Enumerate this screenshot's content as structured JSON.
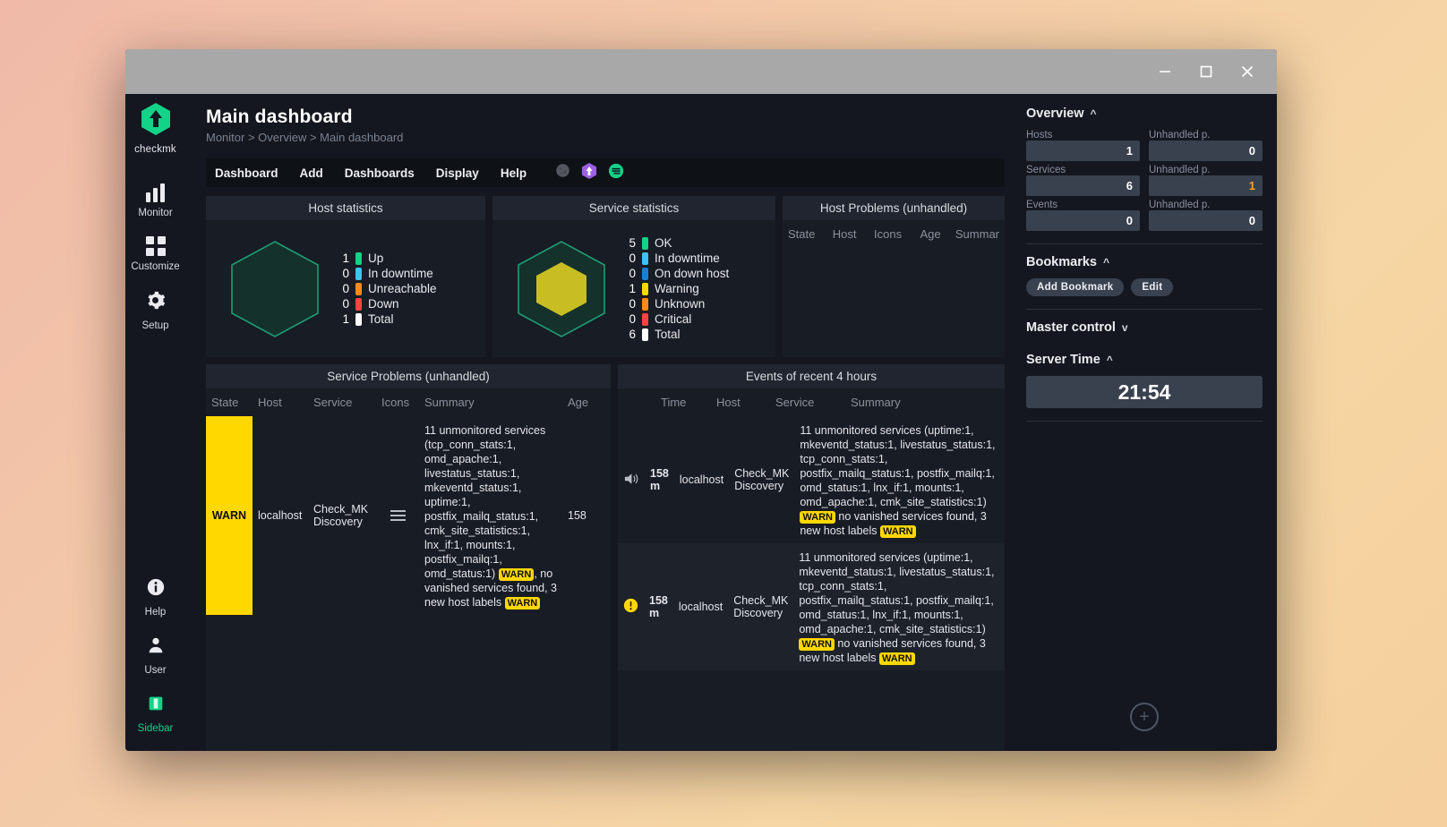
{
  "window": {
    "minimize_label": "minimize",
    "maximize_label": "maximize",
    "close_label": "close"
  },
  "leftnav": {
    "logo_text": "checkmk",
    "items": [
      {
        "label": "Monitor",
        "icon": "bar-chart-icon"
      },
      {
        "label": "Customize",
        "icon": "grid-icon"
      },
      {
        "label": "Setup",
        "icon": "gear-icon"
      }
    ],
    "bottom_items": [
      {
        "label": "Help",
        "icon": "info-icon"
      },
      {
        "label": "User",
        "icon": "person-icon"
      },
      {
        "label": "Sidebar",
        "icon": "sidebar-toggle-icon"
      }
    ]
  },
  "header": {
    "title": "Main dashboard",
    "breadcrumb": "Monitor > Overview > Main dashboard"
  },
  "menubar": {
    "items": [
      "Dashboard",
      "Add",
      "Dashboards",
      "Display",
      "Help"
    ],
    "icons": [
      "moon-icon",
      "checkmk-hexagon-icon",
      "burger-circle-icon"
    ]
  },
  "host_statistics": {
    "title": "Host statistics",
    "rows": [
      {
        "count": "1",
        "label": "Up",
        "color": "#13d388"
      },
      {
        "count": "0",
        "label": "In downtime",
        "color": "#3fc3f0"
      },
      {
        "count": "0",
        "label": "Unreachable",
        "color": "#ff8c1a"
      },
      {
        "count": "0",
        "label": "Down",
        "color": "#f9453f"
      },
      {
        "count": "1",
        "label": "Total",
        "color": "#ffffff"
      }
    ]
  },
  "service_statistics": {
    "title": "Service statistics",
    "rows": [
      {
        "count": "5",
        "label": "OK",
        "color": "#13d388"
      },
      {
        "count": "0",
        "label": "In downtime",
        "color": "#3fc3f0"
      },
      {
        "count": "0",
        "label": "On down host",
        "color": "#1c7fd1"
      },
      {
        "count": "1",
        "label": "Warning",
        "color": "#ffd800"
      },
      {
        "count": "0",
        "label": "Unknown",
        "color": "#ff8c1a"
      },
      {
        "count": "0",
        "label": "Critical",
        "color": "#f9453f"
      },
      {
        "count": "6",
        "label": "Total",
        "color": "#ffffff"
      }
    ]
  },
  "host_problems": {
    "title": "Host Problems (unhandled)",
    "columns": [
      "State",
      "Host",
      "Icons",
      "Age",
      "Summar"
    ],
    "rows": []
  },
  "service_problems": {
    "title": "Service Problems (unhandled)",
    "columns": [
      "State",
      "Host",
      "Service",
      "Icons",
      "Summary",
      "Age"
    ],
    "rows": [
      {
        "state": "WARN",
        "host": "localhost",
        "service": "Check_MK Discovery",
        "icons": "hamburger-icon",
        "summary_pre": "11 unmonitored services (tcp_conn_stats:1, omd_apache:1, livestatus_status:1, mkeventd_status:1, uptime:1, postfix_mailq_status:1, cmk_site_statistics:1, lnx_if:1, mounts:1, postfix_mailq:1, omd_status:1)",
        "badge1": "WARN",
        "summary_mid": ", no vanished services found, 3 new host labels ",
        "badge2": "WARN",
        "age": "158"
      }
    ]
  },
  "events": {
    "title": "Events of recent 4 hours",
    "columns": [
      "Time",
      "Host",
      "Service",
      "Summary"
    ],
    "rows": [
      {
        "icon": "speaker-icon",
        "time": "158 m",
        "host": "localhost",
        "service": "Check_MK Discovery",
        "summary_pre": "11 unmonitored services (uptime:1, mkeventd_status:1, livestatus_status:1, tcp_conn_stats:1, postfix_mailq_status:1, postfix_mailq:1, omd_status:1, lnx_if:1, mounts:1, omd_apache:1, cmk_site_statistics:1)",
        "badge1": "WARN",
        "summary_mid": " no vanished services found, 3 new host labels ",
        "badge2": "WARN"
      },
      {
        "icon": "warning-circle-icon",
        "time": "158 m",
        "host": "localhost",
        "service": "Check_MK Discovery",
        "summary_pre": "11 unmonitored services (uptime:1, mkeventd_status:1, livestatus_status:1, tcp_conn_stats:1, postfix_mailq_status:1, postfix_mailq:1, omd_status:1, lnx_if:1, mounts:1, omd_apache:1, cmk_site_statistics:1)",
        "badge1": "WARN",
        "summary_mid": " no vanished services found, 3 new host labels ",
        "badge2": "WARN"
      }
    ]
  },
  "sidebar": {
    "overview": {
      "title": "Overview",
      "chevron": "collapse",
      "cells": [
        {
          "label": "Hosts",
          "value": "1",
          "warn": false
        },
        {
          "label": "Unhandled p.",
          "value": "0",
          "warn": false
        },
        {
          "label": "Services",
          "value": "6",
          "warn": false
        },
        {
          "label": "Unhandled p.",
          "value": "1",
          "warn": true
        },
        {
          "label": "Events",
          "value": "0",
          "warn": false
        },
        {
          "label": "Unhandled p.",
          "value": "0",
          "warn": false
        }
      ]
    },
    "bookmarks": {
      "title": "Bookmarks",
      "add_label": "Add Bookmark",
      "edit_label": "Edit"
    },
    "master_control": {
      "title": "Master control"
    },
    "server_time": {
      "title": "Server Time",
      "value": "21:54"
    },
    "add_snapin_label": "+"
  },
  "colors": {
    "accent_green": "#13d388",
    "warn_yellow": "#ffd800",
    "panel_bg": "#181c24",
    "app_bg": "#14171f"
  }
}
